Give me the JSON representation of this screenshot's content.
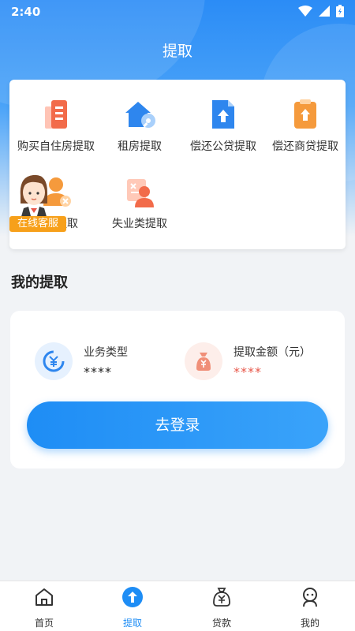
{
  "status_bar": {
    "time": "2:40"
  },
  "header": {
    "title": "提取"
  },
  "services": [
    {
      "label": "购买自住房提取"
    },
    {
      "label": "租房提取"
    },
    {
      "label": "偿还公贷提取"
    },
    {
      "label": "偿还商贷提取"
    },
    {
      "label": "退休提取"
    },
    {
      "label": "失业类提取"
    }
  ],
  "customer_service": {
    "label": "在线客服"
  },
  "my_withdrawal": {
    "title": "我的提取",
    "business_type_label": "业务类型",
    "business_type_value": "****",
    "amount_label": "提取金额（元）",
    "amount_value": "****",
    "login_label": "去登录"
  },
  "tabbar": [
    {
      "label": "首页",
      "icon": "home-icon"
    },
    {
      "label": "提取",
      "icon": "withdraw-icon"
    },
    {
      "label": "贷款",
      "icon": "loan-icon"
    },
    {
      "label": "我的",
      "icon": "profile-icon"
    }
  ],
  "colors": {
    "accent": "#1e8df5",
    "amount": "#e8574a",
    "badge": "#f7a01a"
  }
}
